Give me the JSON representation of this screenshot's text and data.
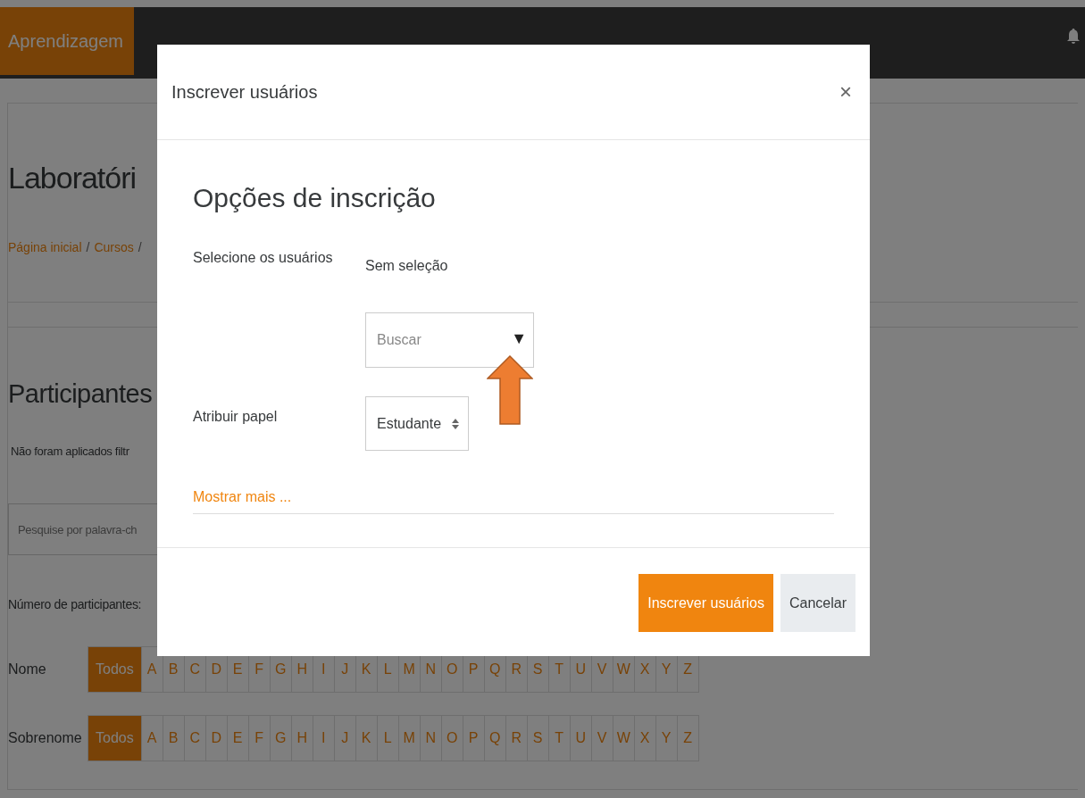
{
  "navbar": {
    "brand": "Aprendizagem"
  },
  "page": {
    "title": "Laboratóri",
    "breadcrumb": [
      "Página inicial",
      "/",
      "Cursos",
      "/"
    ],
    "section_title": "Participantes",
    "filter_note": "Não foram aplicados filtr",
    "search": {
      "placeholder": "Pesquise por palavra-ch"
    },
    "participants_label": "Número de participantes:",
    "letter_bars": [
      {
        "label": "Nome",
        "letters": [
          {
            "label": "Todos",
            "selected": true
          },
          {
            "label": "A",
            "selected": false
          },
          {
            "label": "B",
            "selected": false
          },
          {
            "label": "C",
            "selected": false
          },
          {
            "label": "D",
            "selected": false
          },
          {
            "label": "E",
            "selected": false
          },
          {
            "label": "F",
            "selected": false
          },
          {
            "label": "G",
            "selected": false
          },
          {
            "label": "H",
            "selected": false
          },
          {
            "label": "I",
            "selected": false
          },
          {
            "label": "J",
            "selected": false
          },
          {
            "label": "K",
            "selected": false
          },
          {
            "label": "L",
            "selected": false
          },
          {
            "label": "M",
            "selected": false
          },
          {
            "label": "N",
            "selected": false
          },
          {
            "label": "O",
            "selected": false
          },
          {
            "label": "P",
            "selected": false
          },
          {
            "label": "Q",
            "selected": false
          },
          {
            "label": "R",
            "selected": false
          },
          {
            "label": "S",
            "selected": false
          },
          {
            "label": "T",
            "selected": false
          },
          {
            "label": "U",
            "selected": false
          },
          {
            "label": "V",
            "selected": false
          },
          {
            "label": "W",
            "selected": false
          },
          {
            "label": "X",
            "selected": false
          },
          {
            "label": "Y",
            "selected": false
          },
          {
            "label": "Z",
            "selected": false
          }
        ]
      },
      {
        "label": "Sobrenome",
        "letters": [
          {
            "label": "Todos",
            "selected": true
          },
          {
            "label": "A",
            "selected": false
          },
          {
            "label": "B",
            "selected": false
          },
          {
            "label": "C",
            "selected": false
          },
          {
            "label": "D",
            "selected": false
          },
          {
            "label": "E",
            "selected": false
          },
          {
            "label": "F",
            "selected": false
          },
          {
            "label": "G",
            "selected": false
          },
          {
            "label": "H",
            "selected": false
          },
          {
            "label": "I",
            "selected": false
          },
          {
            "label": "J",
            "selected": false
          },
          {
            "label": "K",
            "selected": false
          },
          {
            "label": "L",
            "selected": false
          },
          {
            "label": "M",
            "selected": false
          },
          {
            "label": "N",
            "selected": false
          },
          {
            "label": "O",
            "selected": false
          },
          {
            "label": "P",
            "selected": false
          },
          {
            "label": "Q",
            "selected": false
          },
          {
            "label": "R",
            "selected": false
          },
          {
            "label": "S",
            "selected": false
          },
          {
            "label": "T",
            "selected": false
          },
          {
            "label": "U",
            "selected": false
          },
          {
            "label": "V",
            "selected": false
          },
          {
            "label": "W",
            "selected": false
          },
          {
            "label": "X",
            "selected": false
          },
          {
            "label": "Y",
            "selected": false
          },
          {
            "label": "Z",
            "selected": false
          }
        ]
      }
    ]
  },
  "modal": {
    "title": "Inscrever usuários",
    "close": "×",
    "heading": "Opções de inscrição",
    "select_users_label": "Selecione os usuários",
    "selection": "Sem seleção",
    "search": {
      "placeholder": "Buscar",
      "caret": "▼"
    },
    "role_label": "Atribuir papel",
    "role": {
      "value": "Estudante"
    },
    "show_more": "Mostrar mais ...",
    "buttons": [
      {
        "label": "Inscrever usuários",
        "kind": "primary"
      },
      {
        "label": "Cancelar",
        "kind": "secondary"
      }
    ]
  }
}
